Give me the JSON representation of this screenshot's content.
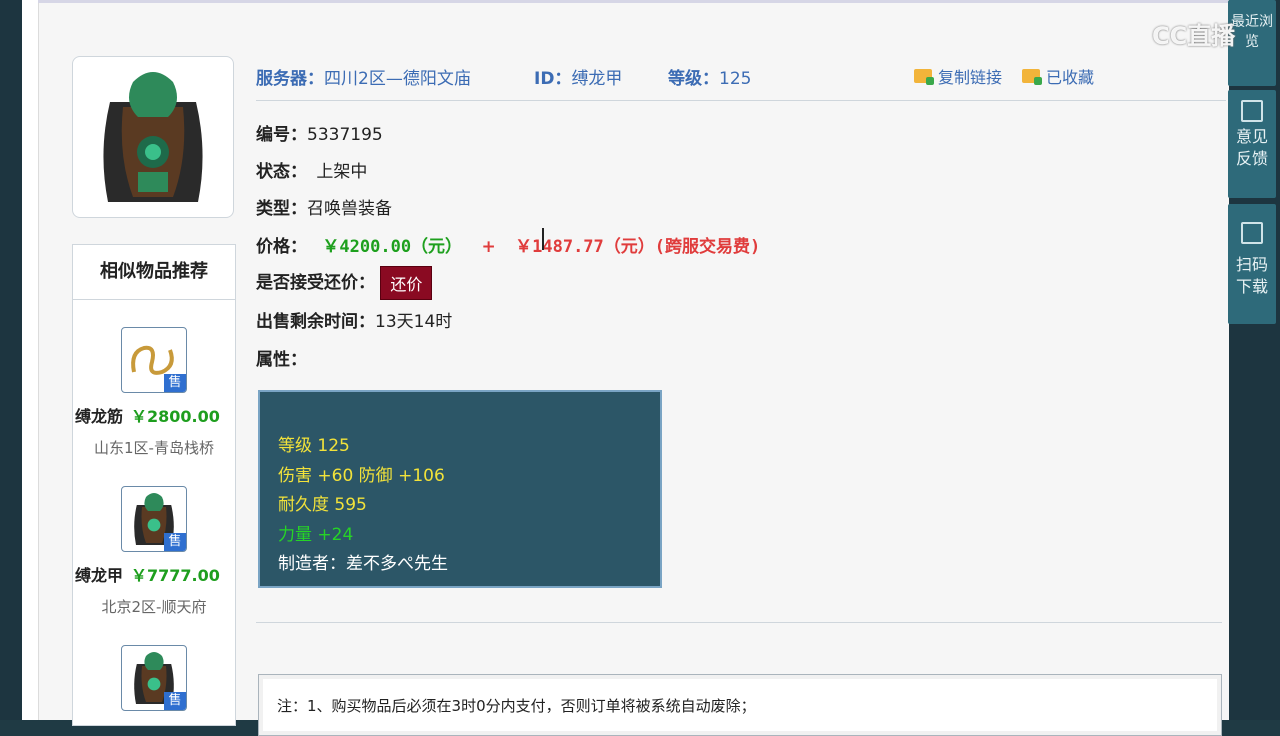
{
  "header": {
    "server_label": "服务器：",
    "server_value": "四川2区—德阳文庙",
    "id_label": "ID：",
    "id_value": "缚龙甲",
    "level_label": "等级：",
    "level_value": "125",
    "copy_link": "复制链接",
    "favorite": "已收藏"
  },
  "details": {
    "number_label": "编号：",
    "number_value": "5337195",
    "status_label": "状态：",
    "status_value": "上架中",
    "type_label": "类型：",
    "type_value": "召唤兽装备",
    "price_label": "价格：",
    "price_value": "￥4200.00（元）",
    "plus": "+",
    "fee_value": "￥1487.77（元）(跨服交易费)",
    "counter_label": "是否接受还价：",
    "counter_button": "还价",
    "time_label": "出售剩余时间：",
    "time_value": "13天14时",
    "attr_label": "属性："
  },
  "attributes": {
    "line1": "等级 125",
    "line2": "伤害 +60 防御 +106",
    "line3": "耐久度 595",
    "line4": "力量 +24",
    "line5": "制造者：差不多ぺ先生"
  },
  "sidebar": {
    "title": "相似物品推荐",
    "items": [
      {
        "name": "缚龙筋",
        "price": "￥2800.00",
        "server": "山东1区-青岛栈桥",
        "tag": "售"
      },
      {
        "name": "缚龙甲",
        "price": "￥7777.00",
        "server": "北京2区-顺天府",
        "tag": "售"
      },
      {
        "name": "",
        "price": "",
        "server": "",
        "tag": "售"
      }
    ]
  },
  "notice": {
    "text": "注：1、购买物品后必须在3时0分内支付，否则订单将被系统自动废除；"
  },
  "side_tools": {
    "recent": "最近浏览",
    "feedback_1": "意见",
    "feedback_2": "反馈",
    "scan_1": "扫码",
    "scan_2": "下载"
  },
  "watermark": {
    "text": "CC直播"
  },
  "colors": {
    "link_blue": "#3c6cb4",
    "price_green": "#1ea01e",
    "price_red": "#e03c3c",
    "counter_button_bg": "#8a0a22",
    "attr_panel_bg": "#2c5667"
  }
}
